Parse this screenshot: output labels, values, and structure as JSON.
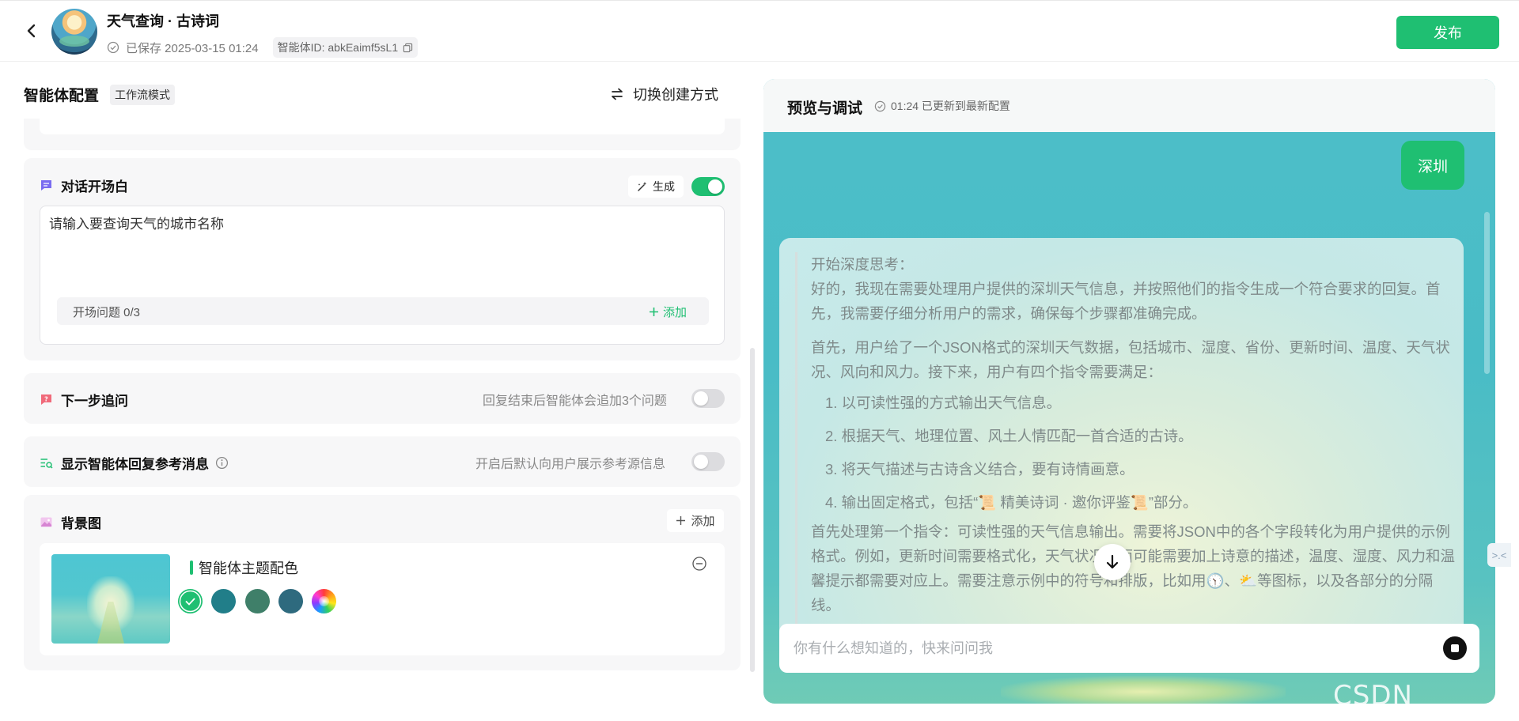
{
  "header": {
    "agent_name": "天气查询 · 古诗词",
    "saved_text": "已保存 2025-03-15 01:24",
    "agent_id": "智能体ID: abkEaimf5sL1",
    "publish_label": "发布"
  },
  "config": {
    "title": "智能体配置",
    "mode_tag": "工作流模式",
    "switch_label": "切换创建方式",
    "opening": {
      "title": "对话开场白",
      "generate_label": "生成",
      "enabled": true,
      "text": "请输入要查询天气的城市名称",
      "questions_label": "开场问题 0/3",
      "add_label": "添加"
    },
    "followup": {
      "title": "下一步追问",
      "hint": "回复结束后智能体会追加3个问题",
      "enabled": false
    },
    "reference": {
      "title": "显示智能体回复参考消息",
      "hint": "开启后默认向用户展示参考源信息",
      "enabled": false
    },
    "background": {
      "title": "背景图",
      "add_label": "添加",
      "theme_title": "智能体主题配色",
      "swatches": [
        "#1fbf72",
        "#217e89",
        "#3f7f69",
        "#2e6a7e",
        "rainbow"
      ]
    }
  },
  "preview": {
    "title": "预览与调试",
    "status": "01:24 已更新到最新配置",
    "user_message": "深圳",
    "thinking": {
      "intro": "开始深度思考：",
      "p1": "好的，我现在需要处理用户提供的深圳天气信息，并按照他们的指令生成一个符合要求的回复。首先，我需要仔细分析用户的需求，确保每个步骤都准确完成。",
      "p2": "首先，用户给了一个JSON格式的深圳天气数据，包括城市、湿度、省份、更新时间、温度、天气状况、风向和风力。接下来，用户有四个指令需要满足：",
      "items": [
        "1. 以可读性强的方式输出天气信息。",
        "2. 根据天气、地理位置、风土人情匹配一首合适的古诗。",
        "3. 将天气描述与古诗含义结合，要有诗情画意。",
        "4. 输出固定格式，包括“📜 精美诗词 · 邀你评鉴📜”部分。"
      ],
      "p3": "首先处理第一个指令：可读性强的天气信息输出。需要将JSON中的各个字段转化为用户提供的示例格式。例如，更新时间需要格式化，天气状况后面可能需要加上诗意的描述，温度、湿度、风力和温馨提示都需要对应上。需要注意示例中的符号和排版，比如用🕥、⛅等图标，以及各部分的分隔线。"
    },
    "input_placeholder": "你有什么想知道的，快来问问我"
  },
  "watermark": "CSDN @kocor",
  "side_tab": ">.<"
}
